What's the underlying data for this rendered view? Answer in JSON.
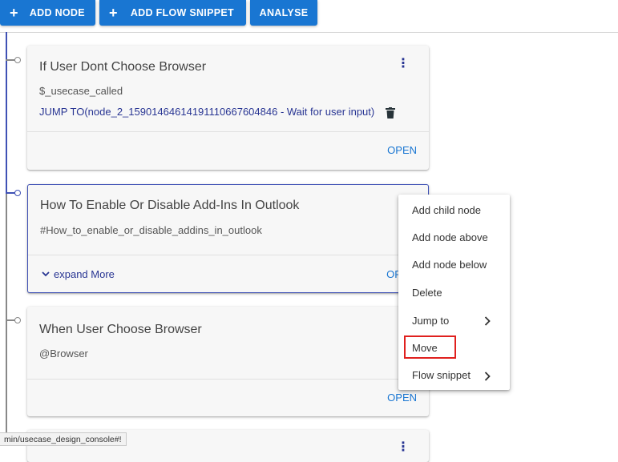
{
  "toolbar": {
    "add_node": "ADD NODE",
    "add_flow_snippet": "ADD FLOW SNIPPET",
    "analyse": "ANALYSE",
    "plus": "+"
  },
  "cards": [
    {
      "title": "If User Dont Choose Browser",
      "subtitle": "$_usecase_called",
      "jump": "JUMP TO(node_2_15901464614191110667604846 - Wait for user input)",
      "open": "OPEN"
    },
    {
      "title": "How To Enable Or Disable Add-Ins In Outlook",
      "subtitle": "#How_to_enable_or_disable_addins_in_outlook",
      "expand": "expand More",
      "open": "OPEN"
    },
    {
      "title": "When User Choose Browser",
      "subtitle": "@Browser",
      "open": "OPEN"
    }
  ],
  "context_menu": {
    "items": [
      "Add child node",
      "Add node above",
      "Add node below",
      "Delete",
      "Jump to",
      "Move",
      "Flow snippet"
    ],
    "highlighted": "Move"
  },
  "status_url": "min/usecase_design_console#!",
  "colors": {
    "primary": "#1976d2",
    "link": "#283593",
    "tree_line_active": "#3f51b5",
    "tree_line": "#888888",
    "highlight_box": "#e0201e"
  }
}
